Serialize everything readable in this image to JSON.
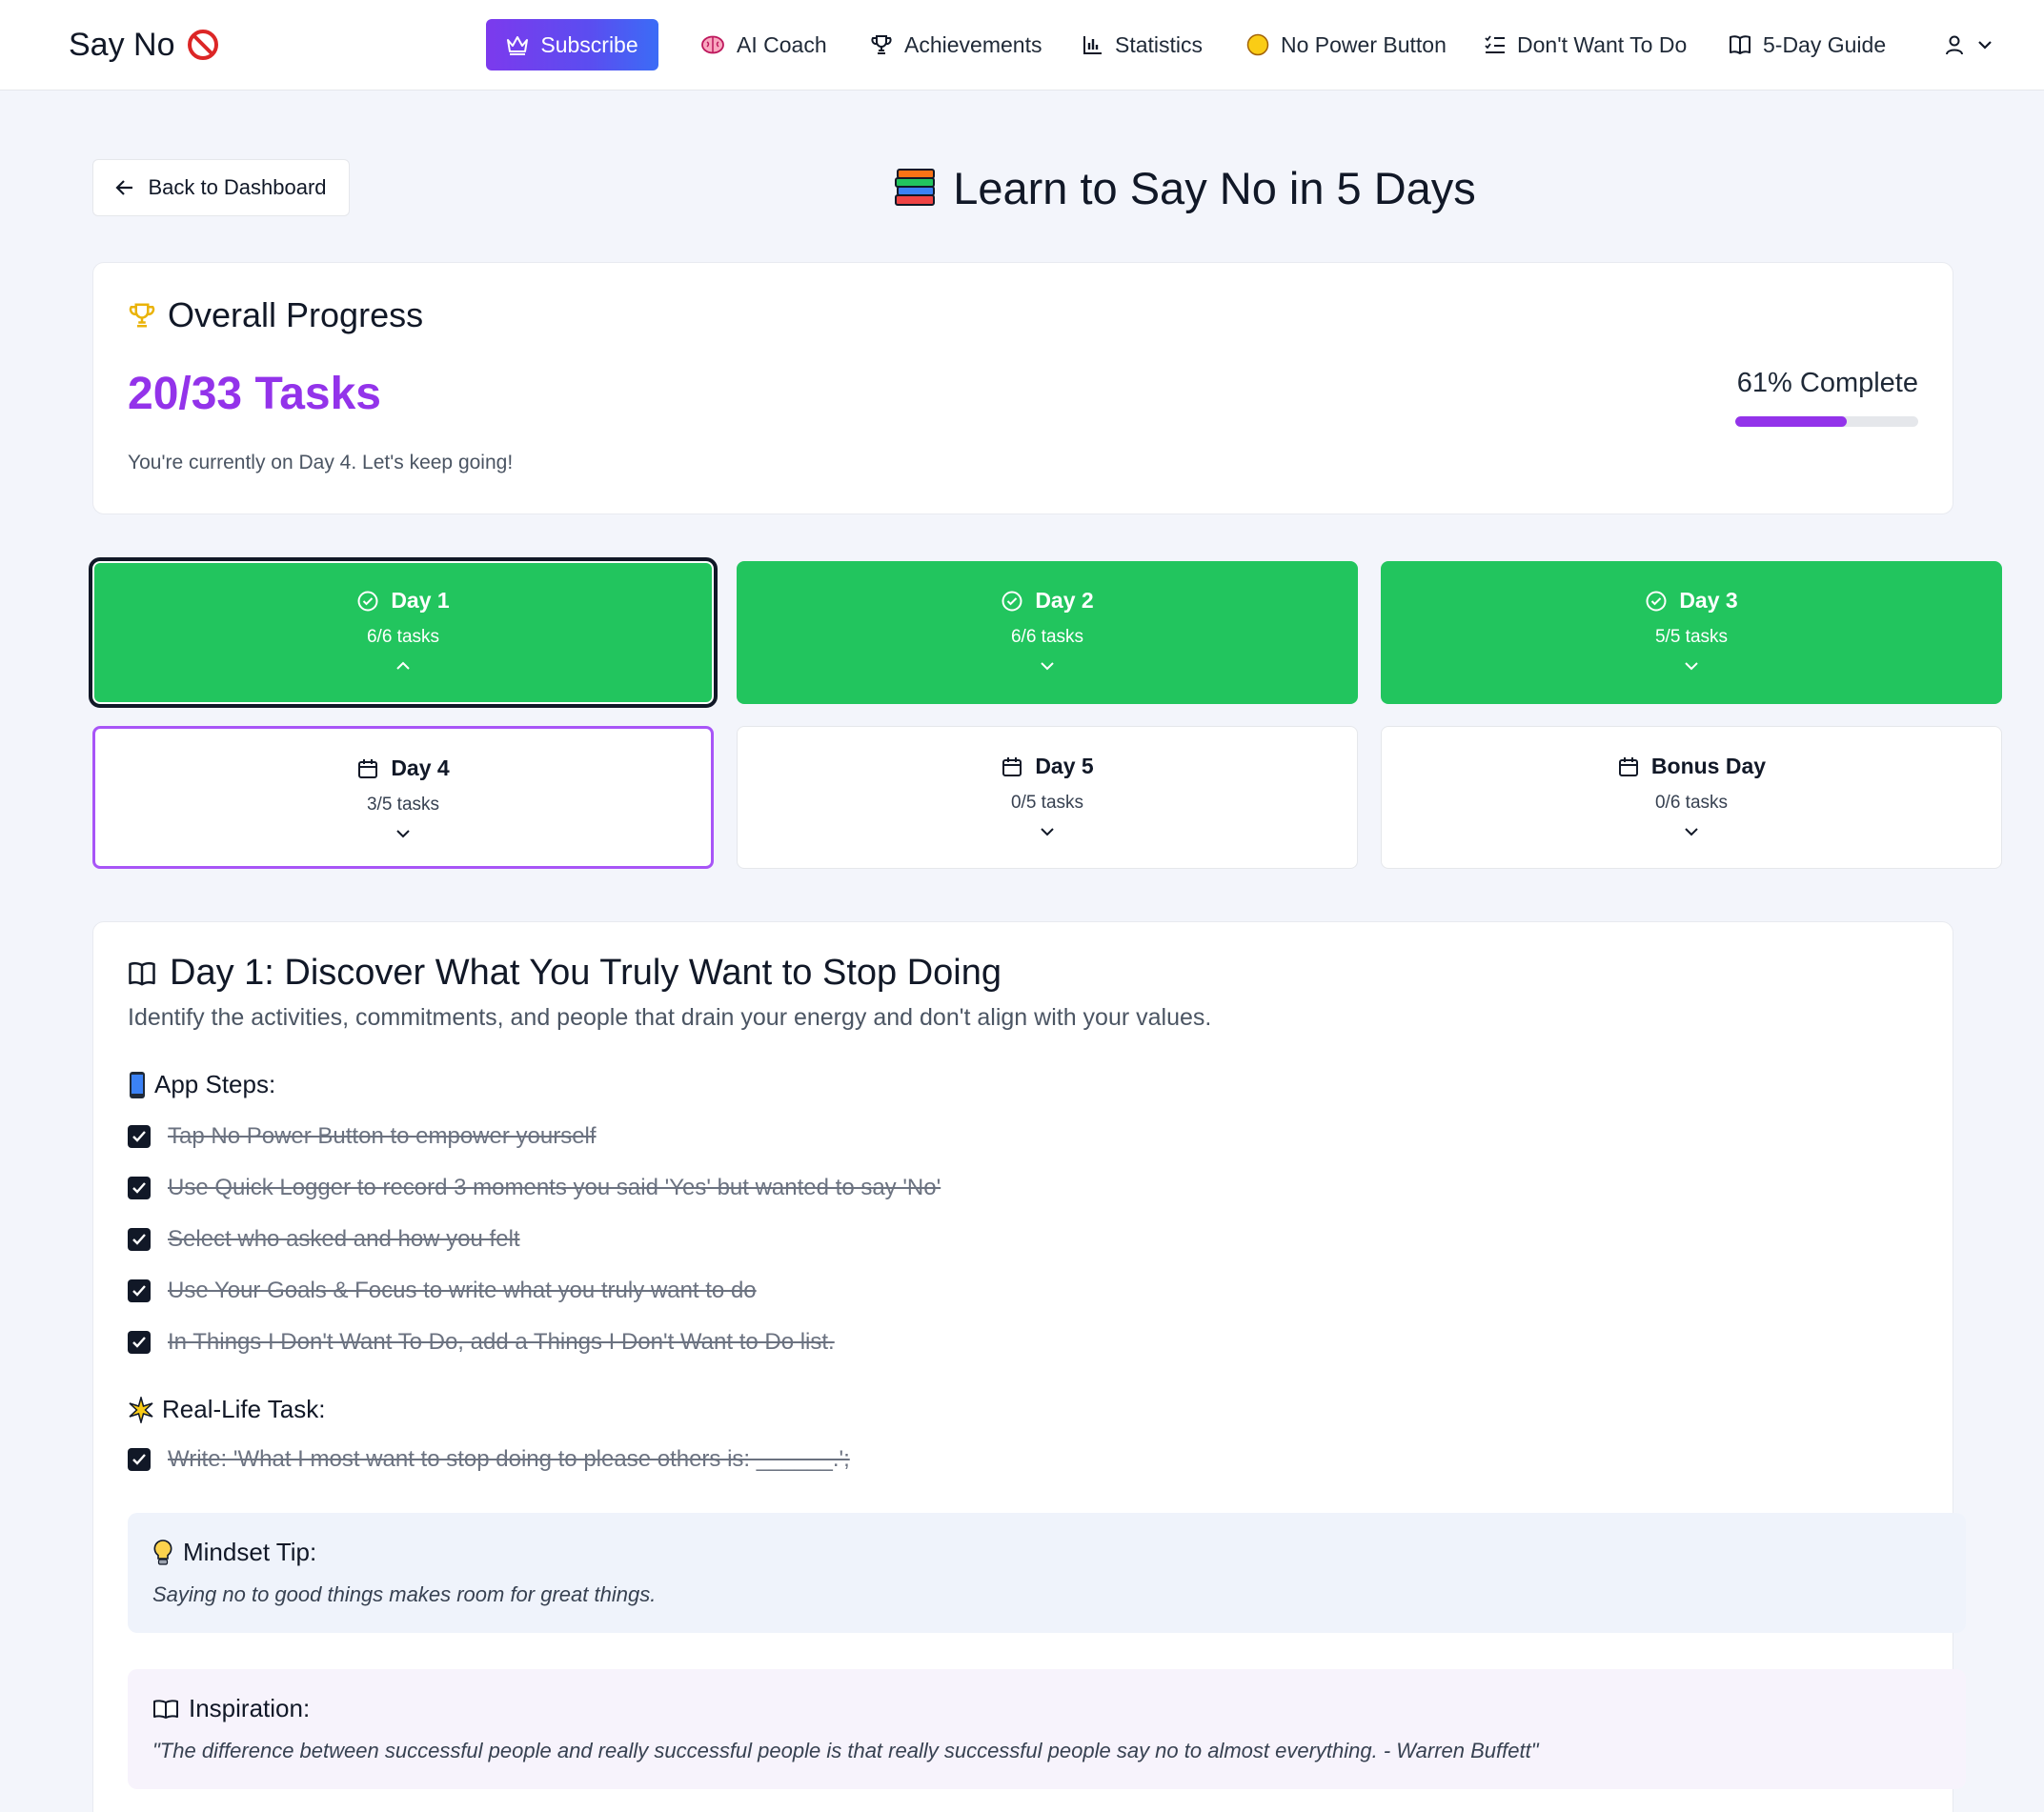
{
  "nav": {
    "brand": "Say No",
    "items": [
      {
        "label": "Subscribe",
        "icon": "crown-icon"
      },
      {
        "label": "AI Coach",
        "icon": "brain-icon"
      },
      {
        "label": "Achievements",
        "icon": "trophy-icon"
      },
      {
        "label": "Statistics",
        "icon": "bar-chart-icon"
      },
      {
        "label": "No Power Button",
        "icon": "yellow-circle-icon"
      },
      {
        "label": "Don't Want To Do",
        "icon": "list-check-icon"
      },
      {
        "label": "5-Day Guide",
        "icon": "book-open-icon"
      }
    ],
    "subscribe_color": "#7c3aed"
  },
  "header": {
    "back_label": "Back to Dashboard",
    "title": "Learn to Say No in 5 Days"
  },
  "progress": {
    "heading": "Overall Progress",
    "count": "20/33 Tasks",
    "subtitle": "You're currently on Day 4. Let's keep going!",
    "percent_label": "61% Complete",
    "percent": 61,
    "accent": "#9333ea"
  },
  "days": [
    {
      "label": "Day 1",
      "tasks": "6/6 tasks",
      "status": "done",
      "expanded": true
    },
    {
      "label": "Day 2",
      "tasks": "6/6 tasks",
      "status": "done",
      "expanded": false
    },
    {
      "label": "Day 3",
      "tasks": "5/5 tasks",
      "status": "done",
      "expanded": false
    },
    {
      "label": "Day 4",
      "tasks": "3/5 tasks",
      "status": "current",
      "expanded": false
    },
    {
      "label": "Day 5",
      "tasks": "0/5 tasks",
      "status": "todo",
      "expanded": false
    },
    {
      "label": "Bonus Day",
      "tasks": "0/6 tasks",
      "status": "todo",
      "expanded": false
    }
  ],
  "detail": {
    "title": "Day 1: Discover What You Truly Want to Stop Doing",
    "description": "Identify the activities, commitments, and people that drain your energy and don't align with your values.",
    "app_steps_heading": "App Steps:",
    "app_steps": [
      "Tap No Power Button to empower yourself",
      "Use Quick Logger to record 3 moments you said 'Yes' but wanted to say 'No'",
      "Select who asked and how you felt",
      "Use Your Goals & Focus to write what you truly want to do",
      "In Things I Don't Want To Do, add a Things I Don't Want to Do list."
    ],
    "real_life_heading": "Real-Life Task:",
    "real_life_task": "Write: 'What I most want to stop doing to please others is: ______.';",
    "mindset_heading": "Mindset Tip:",
    "mindset_text": "Saying no to good things makes room for great things.",
    "inspiration_heading": "Inspiration:",
    "inspiration_text": "\"The difference between successful people and really successful people is that really successful people say no to almost everything. - Warren Buffett\""
  },
  "colors": {
    "done": "#22c55e",
    "current_border": "#a855f7"
  }
}
